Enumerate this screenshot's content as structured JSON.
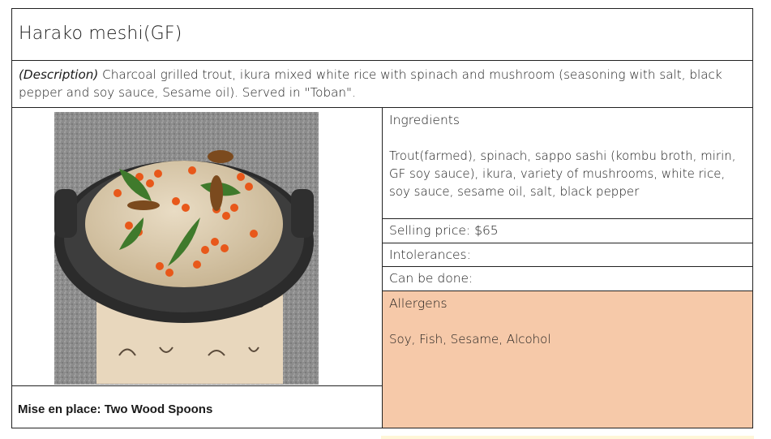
{
  "dish": {
    "title": "Harako meshi(GF)",
    "description_label": "(Description)",
    "description_text": " Charcoal grilled trout, ikura mixed white rice with spinach and mushroom (seasoning with salt, black pepper and soy sauce, Sesame oil). Served in \"Toban\".",
    "mise_en_place": "Mise en place: Two Wood Spoons"
  },
  "ingredients": {
    "heading": "Ingredients",
    "text": "Trout(farmed), spinach, sappo sashi (kombu broth, mirin, GF soy sauce), ikura, variety of mushrooms, white rice, soy sauce, sesame oil, salt, black pepper"
  },
  "selling_price": {
    "label": "Selling price: ",
    "value": "$65"
  },
  "intolerances": {
    "label": "Intolerances:"
  },
  "can_be_done": {
    "label": "Can be done:"
  },
  "allergens": {
    "heading": "Allergens",
    "text": "Soy, Fish, Sesame, Alcohol",
    "color": "#f6c9a9"
  },
  "photo": {
    "icon": "dish-photo"
  }
}
